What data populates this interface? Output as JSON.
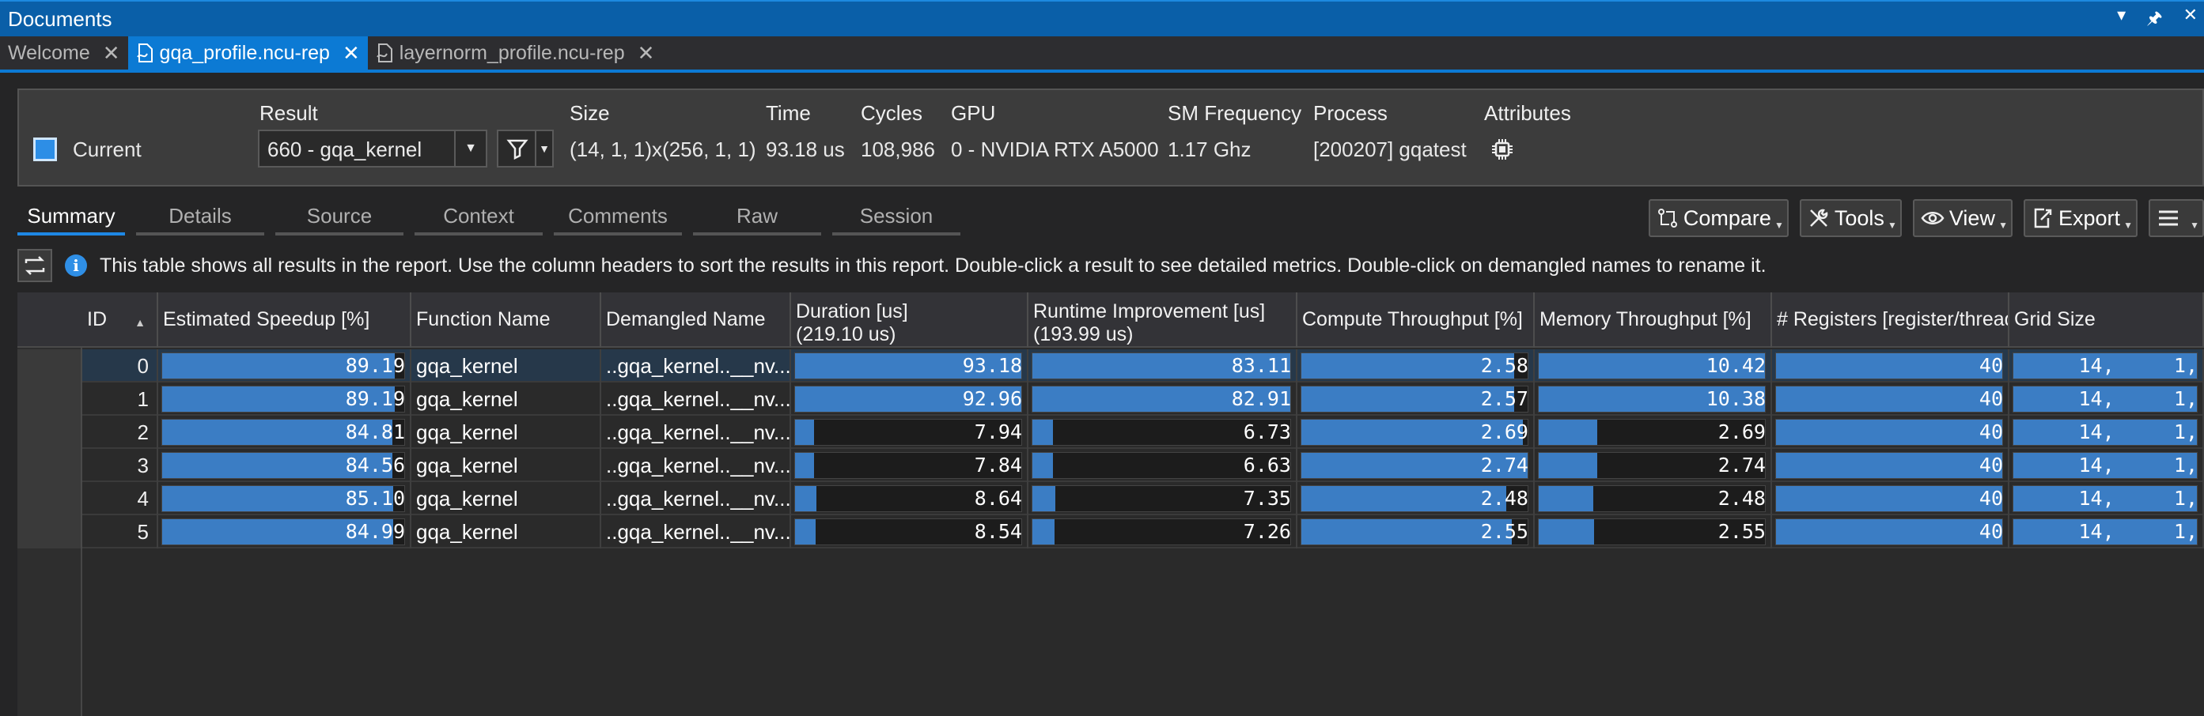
{
  "window": {
    "title": "Documents"
  },
  "tabs": [
    {
      "label": "Welcome",
      "active": false
    },
    {
      "label": "gqa_profile.ncu-rep",
      "active": true
    },
    {
      "label": "layernorm_profile.ncu-rep",
      "active": false
    }
  ],
  "header": {
    "current_label": "Current",
    "result_label": "Result",
    "result_value": "660 - gqa_kernel",
    "size_label": "Size",
    "size_value": "(14, 1, 1)x(256, 1, 1)",
    "time_label": "Time",
    "time_value": "93.18 us",
    "cycles_label": "Cycles",
    "cycles_value": "108,986",
    "gpu_label": "GPU",
    "gpu_value": "0 - NVIDIA RTX A5000",
    "sm_label": "SM Frequency",
    "sm_value": "1.17 Ghz",
    "process_label": "Process",
    "process_value": "[200207] gqatest",
    "attributes_label": "Attributes",
    "current_color": "#2d8ee6"
  },
  "subtabs": [
    "Summary",
    "Details",
    "Source",
    "Context",
    "Comments",
    "Raw",
    "Session"
  ],
  "toolbar": {
    "compare": "Compare",
    "tools": "Tools",
    "view": "View",
    "export": "Export"
  },
  "info": {
    "text": "This table shows all results in the report. Use the column headers to sort the results in this report. Double-click a result to see detailed metrics. Double-click on demangled names to rename it."
  },
  "table": {
    "columns": [
      {
        "line1": "ID",
        "line2": ""
      },
      {
        "line1": "Estimated Speedup [%]",
        "line2": ""
      },
      {
        "line1": "Function Name",
        "line2": ""
      },
      {
        "line1": "Demangled Name",
        "line2": ""
      },
      {
        "line1": "Duration [us]",
        "line2": "(219.10 us)"
      },
      {
        "line1": "Runtime Improvement [us]",
        "line2": "(193.99 us)"
      },
      {
        "line1": "Compute Throughput [%]",
        "line2": ""
      },
      {
        "line1": "Memory Throughput [%]",
        "line2": ""
      },
      {
        "line1": "# Registers [register/thread]",
        "line2": ""
      },
      {
        "line1": "Grid Size",
        "line2": ""
      }
    ],
    "rows": [
      {
        "id": "0",
        "speedup": "89.19",
        "speedup_frac": 0.96,
        "fn": "gqa_kernel",
        "dem": "..gqa_kernel..__nv...",
        "dur": "93.18",
        "dur_frac": 1.0,
        "rt": "83.11",
        "rt_frac": 1.0,
        "ct": "2.58",
        "ct_frac": 0.94,
        "mt": "10.42",
        "mt_frac": 1.0,
        "reg": "40",
        "reg_frac": 1.0,
        "grid": "14,     1,"
      },
      {
        "id": "1",
        "speedup": "89.19",
        "speedup_frac": 0.96,
        "fn": "gqa_kernel",
        "dem": "..gqa_kernel..__nv...",
        "dur": "92.96",
        "dur_frac": 1.0,
        "rt": "82.91",
        "rt_frac": 1.0,
        "ct": "2.57",
        "ct_frac": 0.94,
        "mt": "10.38",
        "mt_frac": 1.0,
        "reg": "40",
        "reg_frac": 1.0,
        "grid": "14,     1,"
      },
      {
        "id": "2",
        "speedup": "84.81",
        "speedup_frac": 0.95,
        "fn": "gqa_kernel",
        "dem": "..gqa_kernel..__nv...",
        "dur": "7.94",
        "dur_frac": 0.085,
        "rt": "6.73",
        "rt_frac": 0.081,
        "ct": "2.69",
        "ct_frac": 0.98,
        "mt": "2.69",
        "mt_frac": 0.26,
        "reg": "40",
        "reg_frac": 1.0,
        "grid": "14,     1,"
      },
      {
        "id": "3",
        "speedup": "84.56",
        "speedup_frac": 0.95,
        "fn": "gqa_kernel",
        "dem": "..gqa_kernel..__nv...",
        "dur": "7.84",
        "dur_frac": 0.084,
        "rt": "6.63",
        "rt_frac": 0.08,
        "ct": "2.74",
        "ct_frac": 1.0,
        "mt": "2.74",
        "mt_frac": 0.26,
        "reg": "40",
        "reg_frac": 1.0,
        "grid": "14,     1,"
      },
      {
        "id": "4",
        "speedup": "85.10",
        "speedup_frac": 0.955,
        "fn": "gqa_kernel",
        "dem": "..gqa_kernel..__nv...",
        "dur": "8.64",
        "dur_frac": 0.093,
        "rt": "7.35",
        "rt_frac": 0.088,
        "ct": "2.48",
        "ct_frac": 0.905,
        "mt": "2.48",
        "mt_frac": 0.24,
        "reg": "40",
        "reg_frac": 1.0,
        "grid": "14,     1,"
      },
      {
        "id": "5",
        "speedup": "84.99",
        "speedup_frac": 0.953,
        "fn": "gqa_kernel",
        "dem": "..gqa_kernel..__nv...",
        "dur": "8.54",
        "dur_frac": 0.092,
        "rt": "7.26",
        "rt_frac": 0.087,
        "ct": "2.55",
        "ct_frac": 0.93,
        "mt": "2.55",
        "mt_frac": 0.245,
        "reg": "40",
        "reg_frac": 1.0,
        "grid": "14,     1,"
      }
    ]
  }
}
